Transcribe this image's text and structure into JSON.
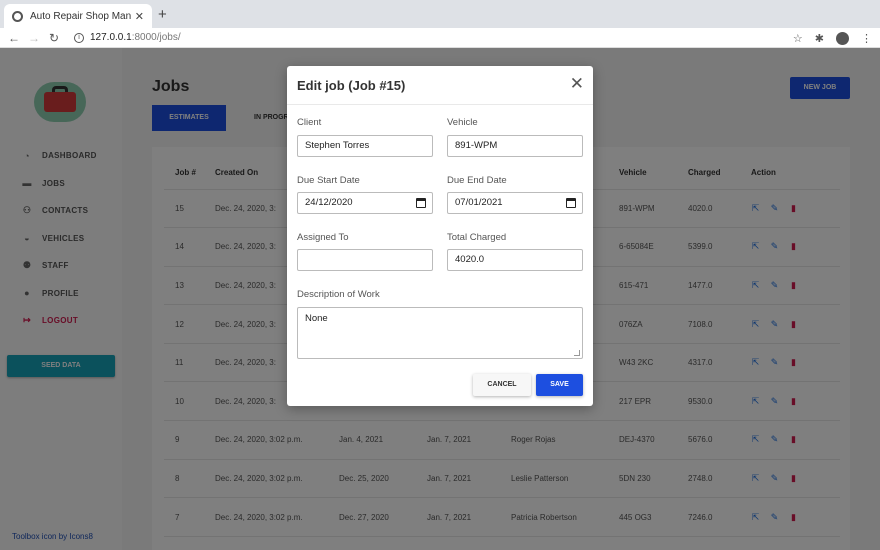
{
  "browser": {
    "tab_title": "Auto Repair Shop Manager",
    "close_glyph": "✕",
    "new_tab_glyph": "+",
    "url_host": "127.0.0.1",
    "url_path": ":8000/jobs/"
  },
  "sidebar": {
    "items": [
      {
        "label": "DASHBOARD",
        "icon": "tachometer-icon",
        "glyph": "◔"
      },
      {
        "label": "JOBS",
        "icon": "toolbox-icon",
        "glyph": "▬"
      },
      {
        "label": "CONTACTS",
        "icon": "users-icon",
        "glyph": "⚇"
      },
      {
        "label": "VEHICLES",
        "icon": "car-icon",
        "glyph": "◒"
      },
      {
        "label": "STAFF",
        "icon": "user-group-icon",
        "glyph": "⚉"
      },
      {
        "label": "PROFILE",
        "icon": "user-icon",
        "glyph": "●"
      },
      {
        "label": "LOGOUT",
        "icon": "sign-out-icon",
        "glyph": "↦"
      }
    ],
    "seed_button": "SEED DATA",
    "credit": "Toolbox icon by Icons8"
  },
  "page": {
    "title": "Jobs",
    "new_job": "NEW JOB",
    "tabs": [
      "ESTIMATES",
      "IN PROGR"
    ]
  },
  "table": {
    "headers": [
      "Job #",
      "Created On",
      "",
      "",
      "",
      "Vehicle",
      "Charged",
      "Action"
    ],
    "rows": [
      {
        "job": "15",
        "created": "Dec. 24, 2020, 3:",
        "start": "",
        "end": "",
        "client": "",
        "vehicle": "891-WPM",
        "charged": "4020.0"
      },
      {
        "job": "14",
        "created": "Dec. 24, 2020, 3:",
        "start": "",
        "end": "",
        "client": "",
        "vehicle": "6-65084E",
        "charged": "5399.0"
      },
      {
        "job": "13",
        "created": "Dec. 24, 2020, 3:",
        "start": "",
        "end": "",
        "client": "",
        "vehicle": "615-471",
        "charged": "1477.0"
      },
      {
        "job": "12",
        "created": "Dec. 24, 2020, 3:",
        "start": "",
        "end": "",
        "client": "",
        "vehicle": "076ZA",
        "charged": "7108.0"
      },
      {
        "job": "11",
        "created": "Dec. 24, 2020, 3:",
        "start": "",
        "end": "",
        "client": "",
        "vehicle": "W43 2KC",
        "charged": "4317.0"
      },
      {
        "job": "10",
        "created": "Dec. 24, 2020, 3:",
        "start": "",
        "end": "",
        "client": "",
        "vehicle": "217 EPR",
        "charged": "9530.0"
      },
      {
        "job": "9",
        "created": "Dec. 24, 2020, 3:02 p.m.",
        "start": "Jan. 4, 2021",
        "end": "Jan. 7, 2021",
        "client": "Roger Rojas",
        "vehicle": "DEJ-4370",
        "charged": "5676.0"
      },
      {
        "job": "8",
        "created": "Dec. 24, 2020, 3:02 p.m.",
        "start": "Dec. 25, 2020",
        "end": "Jan. 7, 2021",
        "client": "Leslie Patterson",
        "vehicle": "5DN 230",
        "charged": "2748.0"
      },
      {
        "job": "7",
        "created": "Dec. 24, 2020, 3:02 p.m.",
        "start": "Dec. 27, 2020",
        "end": "Jan. 7, 2021",
        "client": "Patricia Robertson",
        "vehicle": "445 OG3",
        "charged": "7246.0"
      }
    ],
    "action_glyphs": {
      "view": "⇱",
      "edit": "✎",
      "delete": "▮"
    }
  },
  "modal": {
    "title": "Edit job (Job #15)",
    "close_glyph": "✕",
    "client_label": "Client",
    "client_value": "Stephen Torres",
    "vehicle_label": "Vehicle",
    "vehicle_value": "891-WPM",
    "start_label": "Due Start Date",
    "start_value": "24/12/2020",
    "end_label": "Due End Date",
    "end_value": "07/01/2021",
    "assigned_label": "Assigned To",
    "assigned_value": "",
    "charged_label": "Total Charged",
    "charged_value": "4020.0",
    "desc_label": "Description of Work",
    "desc_value": "None",
    "cancel": "CANCEL",
    "save": "SAVE"
  },
  "colors": {
    "primary": "#1d4fe0",
    "seed": "#17a2b8",
    "danger": "#d11a4f"
  }
}
